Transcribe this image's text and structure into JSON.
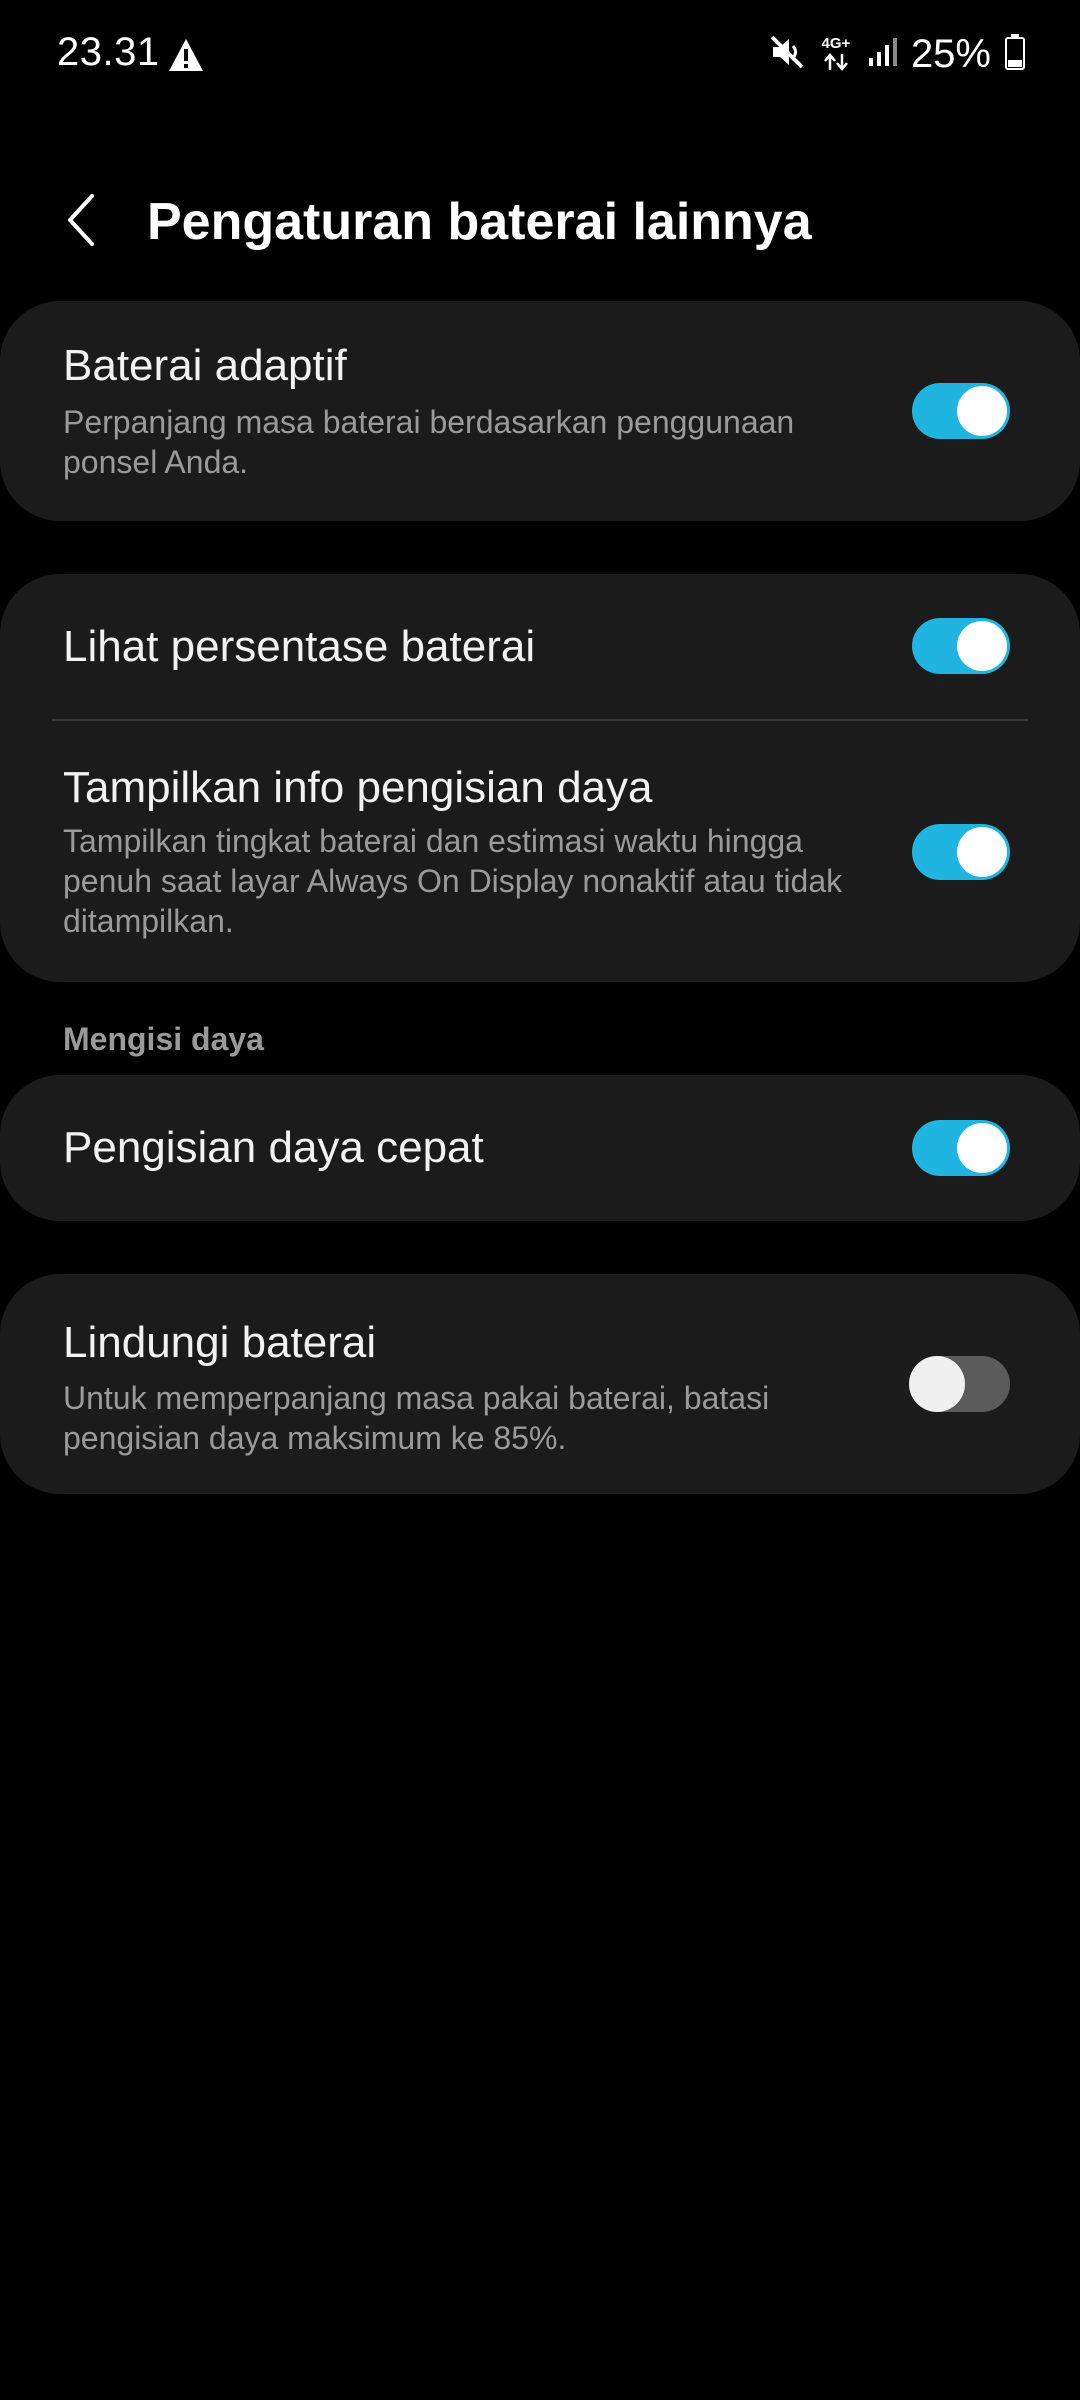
{
  "status_bar": {
    "time": "23.31",
    "battery_percent": "25%",
    "network_label": "4G+",
    "icons": [
      "warning-icon",
      "mute-icon",
      "network-4g-icon",
      "signal-icon",
      "battery-icon"
    ]
  },
  "header": {
    "title": "Pengaturan baterai lainnya",
    "back_icon": "chevron-left-icon"
  },
  "settings": {
    "adaptive_battery": {
      "title": "Baterai adaptif",
      "description": "Perpanjang masa baterai berdasarkan penggunaan ponsel Anda.",
      "enabled": true
    },
    "show_battery_percentage": {
      "title": "Lihat persentase baterai",
      "enabled": true
    },
    "show_charging_info": {
      "title": "Tampilkan info pengisian daya",
      "description": "Tampilkan tingkat baterai dan estimasi waktu hingga penuh saat layar Always On Display nonaktif atau tidak ditampilkan.",
      "enabled": true
    },
    "charging_section_label": "Mengisi daya",
    "fast_charging": {
      "title": "Pengisian daya cepat",
      "enabled": true
    },
    "protect_battery": {
      "title": "Lindungi baterai",
      "description": "Untuk memperpanjang masa pakai baterai, batasi pengisian daya maksimum ke 85%.",
      "enabled": false
    }
  },
  "colors": {
    "background": "#000000",
    "card": "#1b1b1b",
    "toggle_on": "#1fb5e0",
    "toggle_off": "#5b5b5b",
    "secondary_text": "#9a9a9a"
  }
}
